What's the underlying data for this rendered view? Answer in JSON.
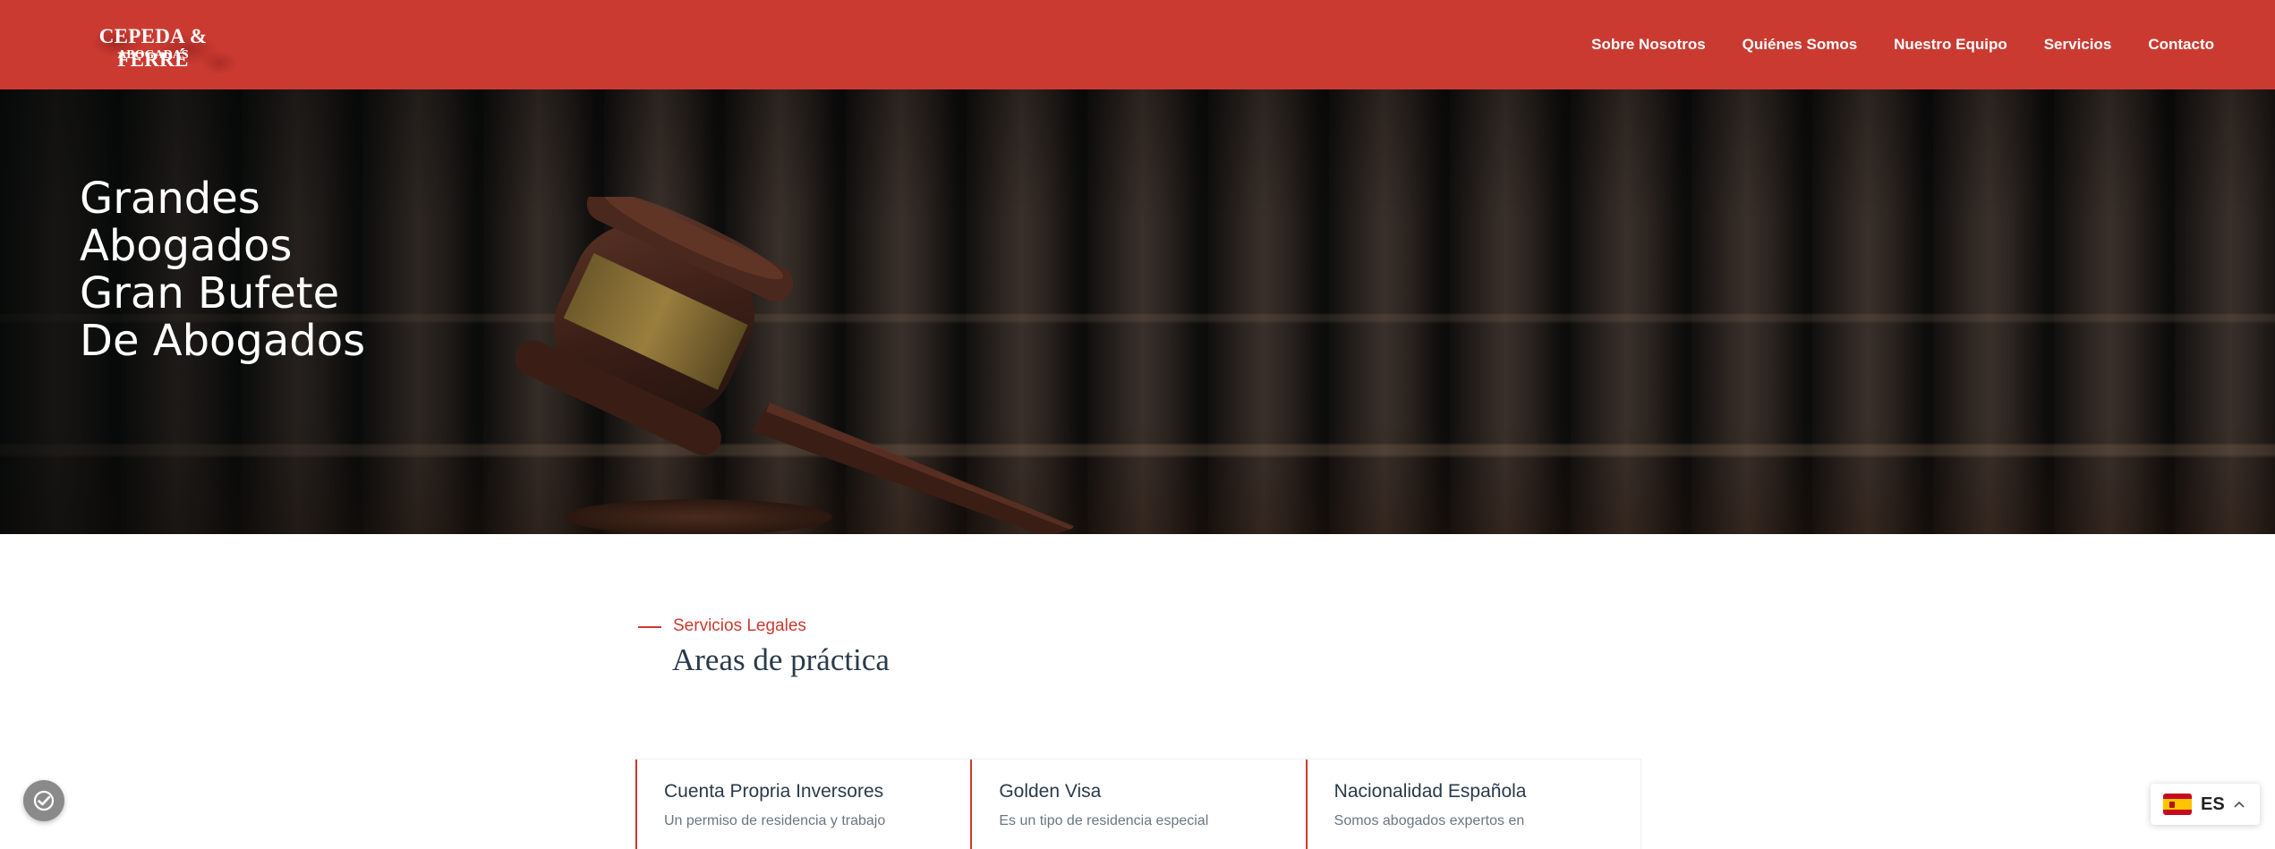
{
  "header": {
    "logo": {
      "name": "CEPEDA & FERRÉ",
      "subtitle": "ABOGADAS"
    },
    "nav": [
      {
        "label": "Sobre Nosotros"
      },
      {
        "label": "Quiénes Somos"
      },
      {
        "label": "Nuestro Equipo"
      },
      {
        "label": "Servicios"
      },
      {
        "label": "Contacto"
      }
    ],
    "brand_color": "#cb3a31"
  },
  "hero": {
    "title_lines": [
      "Grandes",
      "Abogados",
      "Gran Bufete",
      "De Abogados"
    ]
  },
  "practice": {
    "eyebrow": "Servicios Legales",
    "title": "Areas de práctica",
    "cards": [
      {
        "title": "Cuenta Propria Inversores",
        "desc": "Un permiso de residencia y trabajo"
      },
      {
        "title": "Golden Visa",
        "desc": "Es un tipo de residencia especial"
      },
      {
        "title": "Nacionalidad Española",
        "desc": "Somos abogados expertos en"
      }
    ]
  },
  "widgets": {
    "consent_icon": "cookie-check-icon",
    "language": {
      "code": "ES",
      "flag_icon": "spain-flag-icon",
      "caret_icon": "chevron-up-icon"
    }
  }
}
